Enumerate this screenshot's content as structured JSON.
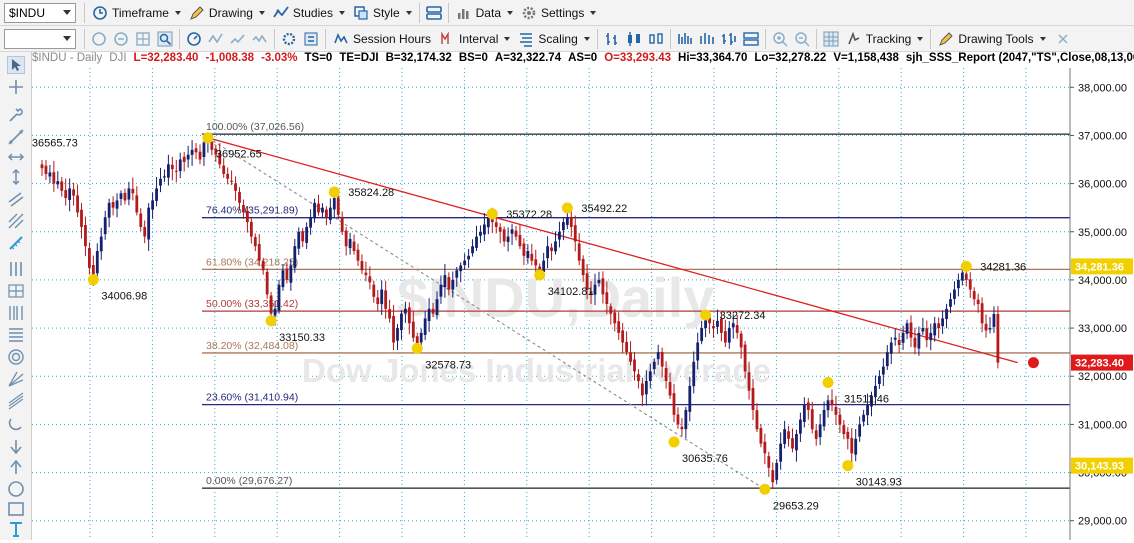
{
  "toolbar1": {
    "symbol": "$INDU",
    "timeframe": "Timeframe",
    "drawing": "Drawing",
    "studies": "Studies",
    "style": "Style",
    "data": "Data",
    "settings": "Settings"
  },
  "toolbar2": {
    "session_hours": "Session Hours",
    "interval": "Interval",
    "scaling": "Scaling",
    "tracking": "Tracking",
    "drawing_tools": "Drawing Tools"
  },
  "info": {
    "title": "$INDU - Daily",
    "exchange": "DJI",
    "last": "L=32,283.40",
    "change": "-1,008.38",
    "change_pct": "-3.03%",
    "ts": "TS=0",
    "te": "TE=DJI",
    "bid": "B=32,174.32",
    "bs": "BS=0",
    "ask": "A=32,322.74",
    "as": "AS=0",
    "open": "O=33,293.43",
    "high": "Hi=33,364.70",
    "low": "Lo=32,278.22",
    "volume": "V=1,158,438",
    "study": "sjh_SSS_Report (2047,\"TS\",Close,08,13,00,"
  },
  "watermark": {
    "line1": "$INDU,Daily",
    "line2": "Dow Jones Industrial Average"
  },
  "colors": {
    "up": "#15206e",
    "down": "#b31a1a",
    "fib_blue": "#27297a",
    "fib_brown": "#a9785a",
    "fib_red": "#b23a3a",
    "fib_gray": "#555555",
    "trend": "#e02020",
    "marker": "#f2d000",
    "price_tag": "#e01a1a",
    "level_tag": "#f2d000",
    "grid": "#2aa9d8"
  },
  "chart_data": {
    "type": "candlestick",
    "ylim": [
      28600,
      38400
    ],
    "y_ticks": [
      "38,000.00",
      "37,000.00",
      "36,000.00",
      "35,000.00",
      "34,000.00",
      "33,000.00",
      "32,000.00",
      "31,000.00",
      "30,000.00",
      "29,000.00"
    ],
    "fib_levels": [
      {
        "label": "100.00% (37,026.56)",
        "value": 37026.56,
        "color": "gray"
      },
      {
        "label": "76.40% (35,291.89)",
        "value": 35291.89,
        "color": "blue"
      },
      {
        "label": "61.80% (34,218.25)",
        "value": 34218.25,
        "color": "brown"
      },
      {
        "label": "50.00% (33,351.42)",
        "value": 33351.42,
        "color": "red"
      },
      {
        "label": "38.20% (32,484.08)",
        "value": 32484.08,
        "color": "brown"
      },
      {
        "label": "23.60% (31,410.94)",
        "value": 31410.94,
        "color": "blue"
      },
      {
        "label": "0.00% (29,676.27)",
        "value": 29676.27,
        "color": "gray"
      }
    ],
    "swing_labels": [
      {
        "text": "36565.73",
        "bar": 2,
        "value": 36565.73,
        "pos": "above"
      },
      {
        "text": "34006.98",
        "bar": 13,
        "value": 34006.98,
        "pos": "below"
      },
      {
        "text": "36952.65",
        "bar": 42,
        "value": 36952.65,
        "pos": "below"
      },
      {
        "text": "33150.33",
        "bar": 58,
        "value": 33150.33,
        "pos": "below"
      },
      {
        "text": "35824.28",
        "bar": 74,
        "value": 35824.28,
        "pos": "right"
      },
      {
        "text": "32578.73",
        "bar": 95,
        "value": 32578.73,
        "pos": "below"
      },
      {
        "text": "35372.28",
        "bar": 114,
        "value": 35372.28,
        "pos": "right"
      },
      {
        "text": "35492.22",
        "bar": 133,
        "value": 35492.22,
        "pos": "right"
      },
      {
        "text": "34102.81",
        "bar": 126,
        "value": 34102.81,
        "pos": "below"
      },
      {
        "text": "33272.34",
        "bar": 168,
        "value": 33272.34,
        "pos": "right"
      },
      {
        "text": "30635.76",
        "bar": 160,
        "value": 30635.76,
        "pos": "below"
      },
      {
        "text": "29653.29",
        "bar": 183,
        "value": 29653.29,
        "pos": "below"
      },
      {
        "text": "31511.46",
        "bar": 201,
        "value": 31870.0,
        "pos": "below"
      },
      {
        "text": "30143.93",
        "bar": 204,
        "value": 30143.93,
        "pos": "below"
      },
      {
        "text": "34281.36",
        "bar": 234,
        "value": 34281.36,
        "pos": "right"
      }
    ],
    "markers": [
      {
        "bar": 13,
        "value": 34006.98
      },
      {
        "bar": 42,
        "value": 36952.65
      },
      {
        "bar": 58,
        "value": 33150.33
      },
      {
        "bar": 74,
        "value": 35824.28
      },
      {
        "bar": 95,
        "value": 32578.73
      },
      {
        "bar": 114,
        "value": 35372.28
      },
      {
        "bar": 126,
        "value": 34102.81
      },
      {
        "bar": 133,
        "value": 35492.22
      },
      {
        "bar": 160,
        "value": 30635.76
      },
      {
        "bar": 168,
        "value": 33272.34
      },
      {
        "bar": 183,
        "value": 29653.29
      },
      {
        "bar": 199,
        "value": 31870.0
      },
      {
        "bar": 204,
        "value": 30143.93
      },
      {
        "bar": 234,
        "value": 34281.36
      }
    ],
    "trendlines": [
      {
        "from_bar": 42,
        "from_value": 36952.65,
        "to_bar": 247,
        "to_value": 32283.4,
        "style": "solid",
        "color": "red"
      },
      {
        "from_bar": 42,
        "from_value": 36952.65,
        "to_bar": 183,
        "to_value": 29653.29,
        "style": "dashed",
        "color": "gray"
      }
    ],
    "last_marker": {
      "bar": 251,
      "value": 32283.4
    },
    "price_tags": [
      {
        "text": "34,281.36",
        "value": 34281.36,
        "style": "level"
      },
      {
        "text": "32,283.40",
        "value": 32283.4,
        "style": "price"
      },
      {
        "text": "30,143.93",
        "value": 30143.93,
        "style": "level"
      }
    ],
    "bar_count": 248,
    "closes": [
      36320,
      36200,
      36230,
      36000,
      36050,
      35850,
      35700,
      35900,
      35750,
      35400,
      35100,
      34700,
      34250,
      34100,
      34600,
      34900,
      35300,
      35600,
      35500,
      35650,
      35800,
      35650,
      35900,
      35800,
      35400,
      35100,
      34900,
      35500,
      35650,
      35900,
      36100,
      36150,
      36400,
      36300,
      36250,
      36500,
      36450,
      36600,
      36700,
      36650,
      36500,
      36850,
      36900,
      36700,
      36600,
      36400,
      36200,
      36100,
      36050,
      35850,
      35600,
      35400,
      35200,
      34900,
      34700,
      34400,
      34200,
      33700,
      33300,
      33400,
      33900,
      34200,
      34000,
      34300,
      34700,
      35000,
      34800,
      35100,
      35300,
      35600,
      35400,
      35500,
      35300,
      35500,
      35700,
      35350,
      35000,
      34700,
      34850,
      34600,
      34400,
      34200,
      34100,
      33950,
      33650,
      33500,
      33800,
      33400,
      33200,
      32700,
      33000,
      33300,
      33400,
      33100,
      32800,
      32650,
      32900,
      33200,
      33400,
      33300,
      33600,
      33900,
      34100,
      33800,
      34000,
      34200,
      34300,
      34400,
      34500,
      34700,
      34900,
      35000,
      35150,
      35300,
      35200,
      35100,
      35000,
      34800,
      34900,
      35050,
      34900,
      34700,
      34500,
      34600,
      34400,
      34300,
      34200,
      34400,
      34700,
      34600,
      34800,
      35000,
      35200,
      35300,
      35100,
      34800,
      34400,
      34100,
      33800,
      33700,
      33900,
      34000,
      33700,
      33500,
      33300,
      33100,
      32900,
      32700,
      32500,
      32300,
      32100,
      31900,
      31600,
      31900,
      32100,
      32300,
      32500,
      32200,
      31900,
      31600,
      31200,
      31000,
      30900,
      31300,
      31800,
      32300,
      32700,
      33000,
      33200,
      33100,
      33000,
      33150,
      32900,
      32700,
      33000,
      33100,
      32900,
      32600,
      32100,
      31700,
      31300,
      30900,
      30600,
      30400,
      30100,
      29800,
      30200,
      30600,
      30900,
      30700,
      30500,
      30800,
      31100,
      31400,
      31300,
      30900,
      30700,
      31000,
      31300,
      31500,
      31400,
      31200,
      31000,
      30800,
      30700,
      30400,
      30700,
      31000,
      31200,
      31400,
      31600,
      31800,
      32000,
      32200,
      32500,
      32700,
      32800,
      32650,
      32900,
      33100,
      32800,
      32600,
      32900,
      33000,
      32750,
      32900,
      33100,
      33000,
      33200,
      33400,
      33600,
      33800,
      34000,
      34150,
      34000,
      33800,
      33600,
      33500,
      33100,
      32950,
      33000,
      33293,
      32283
    ]
  }
}
